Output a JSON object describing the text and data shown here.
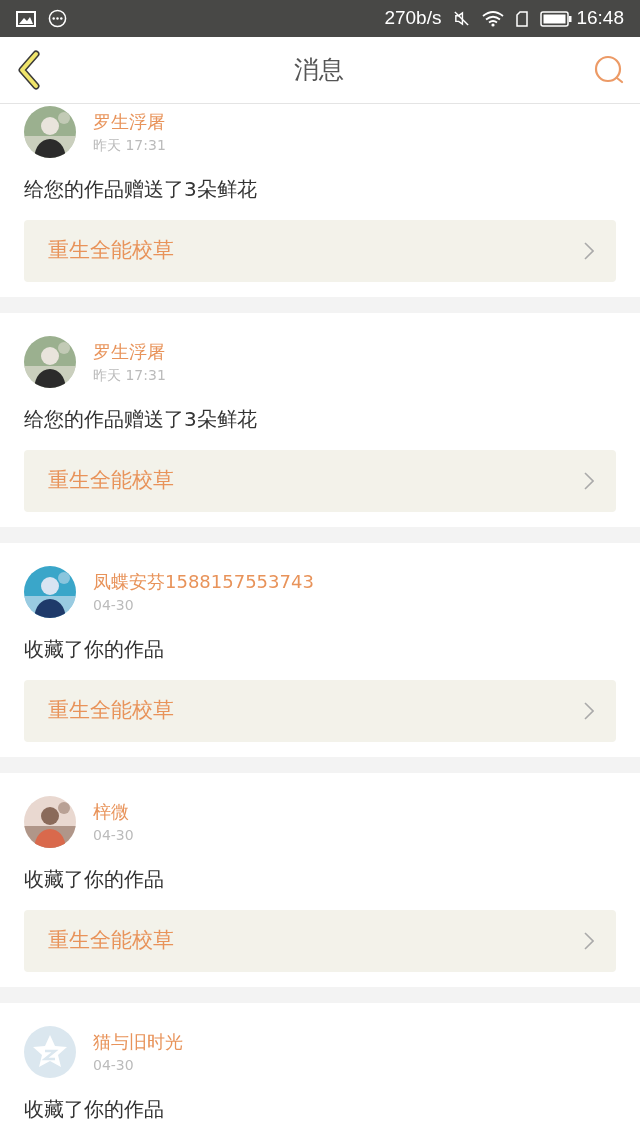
{
  "status_bar": {
    "speed": "270b/s",
    "time": "16:48"
  },
  "header": {
    "title": "消息"
  },
  "messages": [
    {
      "user": "罗生浮屠",
      "time": "昨天 17:31",
      "text": "给您的作品赠送了3朵鲜花",
      "work": "重生全能校草"
    },
    {
      "user": "罗生浮屠",
      "time": "昨天 17:31",
      "text": "给您的作品赠送了3朵鲜花",
      "work": "重生全能校草"
    },
    {
      "user": "凤蝶安芬1588157553743",
      "time": "04-30",
      "text": "收藏了你的作品",
      "work": "重生全能校草"
    },
    {
      "user": "梓微",
      "time": "04-30",
      "text": "收藏了你的作品",
      "work": "重生全能校草"
    },
    {
      "user": "猫与旧时光",
      "time": "04-30",
      "avatar": {
        "kind": "default"
      },
      "text": "收藏了你的作品"
    }
  ]
}
